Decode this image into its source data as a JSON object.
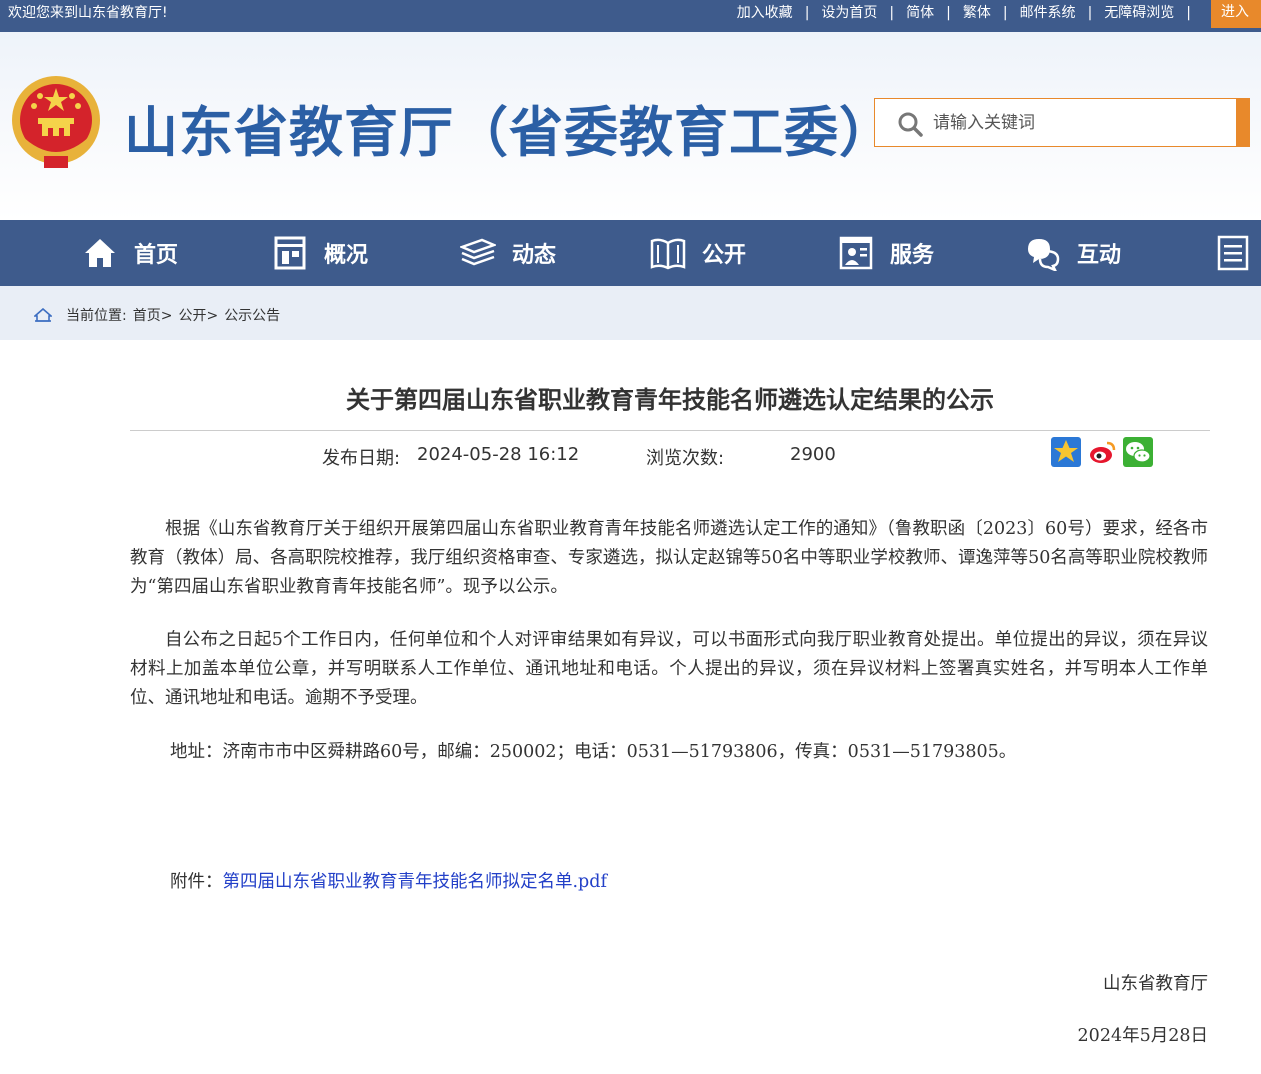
{
  "topbar": {
    "welcome": "欢迎您来到山东省教育厅!",
    "links": [
      "加入收藏",
      "设为首页",
      "简体",
      "繁体",
      "邮件系统",
      "无障碍浏览"
    ],
    "enter": "进入"
  },
  "header": {
    "site_title": "山东省教育厅（省委教育工委）",
    "search_placeholder": "请输入关键词"
  },
  "nav": {
    "items": [
      "首页",
      "概况",
      "动态",
      "公开",
      "服务",
      "互动"
    ]
  },
  "breadcrumb": {
    "label": "当前位置:",
    "items": [
      "首页>",
      "公开>",
      "公示公告"
    ]
  },
  "article": {
    "title": "关于第四届山东省职业教育青年技能名师遴选认定结果的公示",
    "date_label": "发布日期:",
    "date_value": "2024-05-28 16:12",
    "views_label": "浏览次数:",
    "views_value": "2900",
    "paragraphs": [
      "根据《山东省教育厅关于组织开展第四届山东省职业教育青年技能名师遴选认定工作的通知》（鲁教职函〔2023〕60号）要求，经各市教育（教体）局、各高职院校推荐，我厅组织资格审查、专家遴选，拟认定赵锦等50名中等职业学校教师、谭逸萍等50名高等职业院校教师为“第四届山东省职业教育青年技能名师”。现予以公示。",
      "自公布之日起5个工作日内，任何单位和个人对评审结果如有异议，可以书面形式向我厅职业教育处提出。单位提出的异议，须在异议材料上加盖本单位公章，并写明联系人工作单位、通讯地址和电话。个人提出的异议，须在异议材料上签署真实姓名，并写明本人工作单位、通讯地址和电话。逾期不予受理。"
    ],
    "address": "地址：济南市市中区舜耕路60号，邮编：250002；电话：0531—51793806，传真：0531—51793805。",
    "attachment_label": "附件：",
    "attachment_link": "第四届山东省职业教育青年技能名师拟定名单.pdf",
    "signature": "山东省教育厅",
    "sign_date": "2024年5月28日"
  },
  "colors": {
    "primary": "#3e5b8c",
    "accent": "#e8892b",
    "title_blue": "#2b5fa5",
    "link": "#2340c8"
  }
}
